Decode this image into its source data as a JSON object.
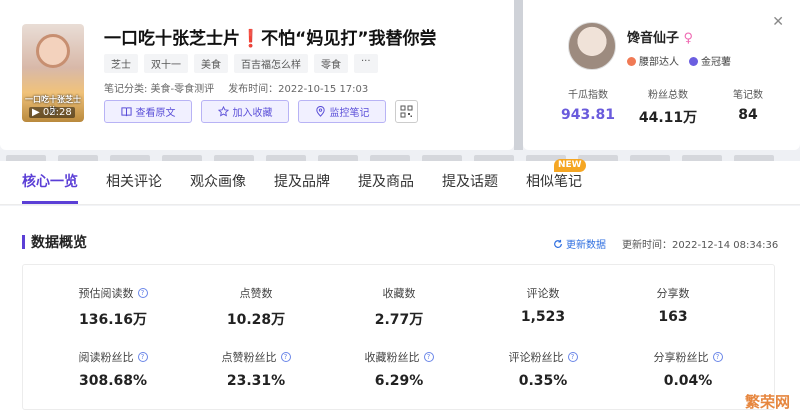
{
  "note": {
    "thumb_overlay": "一口吃十张芝士片",
    "duration": "02:28",
    "title_part1": "一口吃十张芝士片",
    "title_bang": "❗",
    "title_part2": "不怕“妈见打”我替你尝",
    "tags": [
      "芝士",
      "双十一",
      "美食",
      "百吉福怎么样",
      "零食",
      "···"
    ],
    "category": "笔记分类: 美食-零食测评",
    "publish_time": "发布时间：2022-10-15 17:03",
    "actions": {
      "view_original": "查看原文",
      "add_favorite": "加入收藏",
      "monitor_note": "监控笔记"
    }
  },
  "author": {
    "name": "馋音仙子",
    "gender_symbol": "♀",
    "badge1": "腰部达人",
    "badge2": "金冠薯",
    "stats": [
      {
        "label": "千瓜指数",
        "value": "943.81"
      },
      {
        "label": "粉丝总数",
        "value": "44.11万"
      },
      {
        "label": "笔记数",
        "value": "84"
      }
    ]
  },
  "tabs": [
    "核心一览",
    "相关评论",
    "观众画像",
    "提及品牌",
    "提及商品",
    "提及话题",
    "相似笔记"
  ],
  "new_badge": "NEW",
  "overview": {
    "title": "数据概览",
    "refresh": "更新数据",
    "updated": "更新时间：2022-12-14 08:34:36",
    "stats": [
      {
        "label": "预估阅读数",
        "value": "136.16万"
      },
      {
        "label": "点赞数",
        "value": "10.28万"
      },
      {
        "label": "收藏数",
        "value": "2.77万"
      },
      {
        "label": "评论数",
        "value": "1,523"
      },
      {
        "label": "分享数",
        "value": "163"
      },
      {
        "label": "阅读粉丝比",
        "value": "308.68%"
      },
      {
        "label": "点赞粉丝比",
        "value": "23.31%"
      },
      {
        "label": "收藏粉丝比",
        "value": "6.29%"
      },
      {
        "label": "评论粉丝比",
        "value": "0.35%"
      },
      {
        "label": "分享粉丝比",
        "value": "0.04%"
      }
    ]
  },
  "watermark": "繁荣网",
  "colors": {
    "accent": "#5b3fd6",
    "link": "#2f6fe0",
    "new": "#f5a623"
  }
}
